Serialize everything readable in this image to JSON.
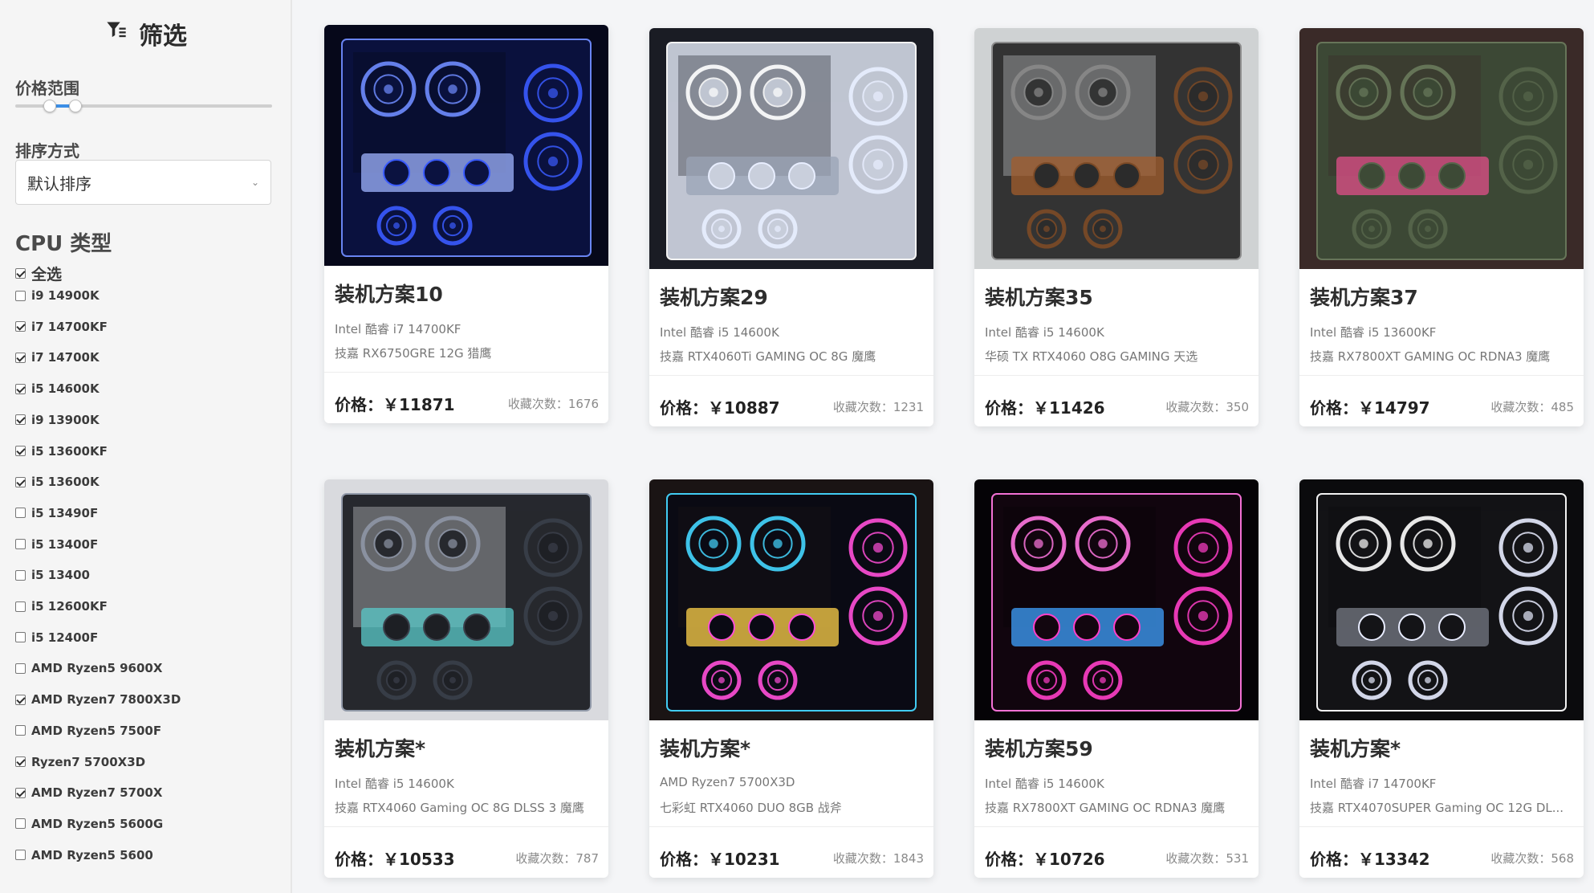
{
  "filter": {
    "title": "筛选",
    "price_range_label": "价格范围",
    "sort_label": "排序方式",
    "sort_value": "默认排序",
    "cpu_type_label": "CPU 类型",
    "cpu_options": [
      {
        "label": "全选",
        "checked": true
      },
      {
        "label": "i9 14900K",
        "checked": false
      },
      {
        "label": "i7 14700KF",
        "checked": true
      },
      {
        "label": "i7 14700K",
        "checked": true
      },
      {
        "label": "i5 14600K",
        "checked": true
      },
      {
        "label": "i9 13900K",
        "checked": true
      },
      {
        "label": "i5 13600KF",
        "checked": true
      },
      {
        "label": "i5 13600K",
        "checked": true
      },
      {
        "label": "i5 13490F",
        "checked": false
      },
      {
        "label": "i5 13400F",
        "checked": false
      },
      {
        "label": "i5 13400",
        "checked": false
      },
      {
        "label": "i5 12600KF",
        "checked": false
      },
      {
        "label": "i5 12400F",
        "checked": false
      },
      {
        "label": "AMD Ryzen5 9600X",
        "checked": false
      },
      {
        "label": "AMD Ryzen7 7800X3D",
        "checked": true
      },
      {
        "label": "AMD Ryzen5 7500F",
        "checked": false
      },
      {
        "label": "Ryzen7 5700X3D",
        "checked": true
      },
      {
        "label": "AMD Ryzen7 5700X",
        "checked": true
      },
      {
        "label": "AMD Ryzen5 5600G",
        "checked": false
      },
      {
        "label": "AMD Ryzen5 5600",
        "checked": false
      }
    ],
    "price_slider": {
      "low_fraction": 0.13,
      "high_fraction": 0.23
    },
    "accent_color": "#3b8ee6"
  },
  "builds": [
    {
      "title": "装机方案10",
      "cpu": "Intel 酷睿 i7 14700KF",
      "gpu": "技嘉 RX6750GRE 12G 猎鹰",
      "price": "价格：￥11871",
      "favorites": "收藏次数：1676",
      "image_theme": "blue"
    },
    {
      "title": "装机方案29",
      "cpu": "Intel 酷睿 i5 14600K",
      "gpu": "技嘉 RTX4060Ti GAMING OC 8G 魔鹰",
      "price": "价格：￥10887",
      "favorites": "收藏次数：1231",
      "image_theme": "white"
    },
    {
      "title": "装机方案35",
      "cpu": "Intel 酷睿 i5 14600K",
      "gpu": "华硕 TX RTX4060 O8G GAMING 天选",
      "price": "价格：￥11426",
      "favorites": "收藏次数：350",
      "image_theme": "wood"
    },
    {
      "title": "装机方案37",
      "cpu": "Intel 酷睿 i5 13600KF",
      "gpu": "技嘉 RX7800XT GAMING OC RDNA3 魔鹰",
      "price": "价格：￥14797",
      "favorites": "收藏次数：485",
      "image_theme": "green"
    },
    {
      "title": "装机方案*",
      "cpu": "Intel 酷睿 i5 14600K",
      "gpu": "技嘉 RTX4060 Gaming OC 8G DLSS 3 魔鹰",
      "price": "价格：￥10533",
      "favorites": "收藏次数：787",
      "image_theme": "gray"
    },
    {
      "title": "装机方案*",
      "cpu": "AMD Ryzen7 5700X3D",
      "gpu": "七彩虹 RTX4060 DUO 8GB 战斧",
      "price": "价格：￥10231",
      "favorites": "收藏次数：1843",
      "image_theme": "rgb"
    },
    {
      "title": "装机方案59",
      "cpu": "Intel 酷睿 i5 14600K",
      "gpu": "技嘉 RX7800XT GAMING OC RDNA3 魔鹰",
      "price": "价格：￥10726",
      "favorites": "收藏次数：531",
      "image_theme": "pink"
    },
    {
      "title": "装机方案*",
      "cpu": "Intel 酷睿 i7 14700KF",
      "gpu": "技嘉 RTX4070SUPER Gaming OC 12G DL...",
      "price": "价格：￥13342",
      "favorites": "收藏次数：568",
      "image_theme": "blackwhite"
    }
  ]
}
